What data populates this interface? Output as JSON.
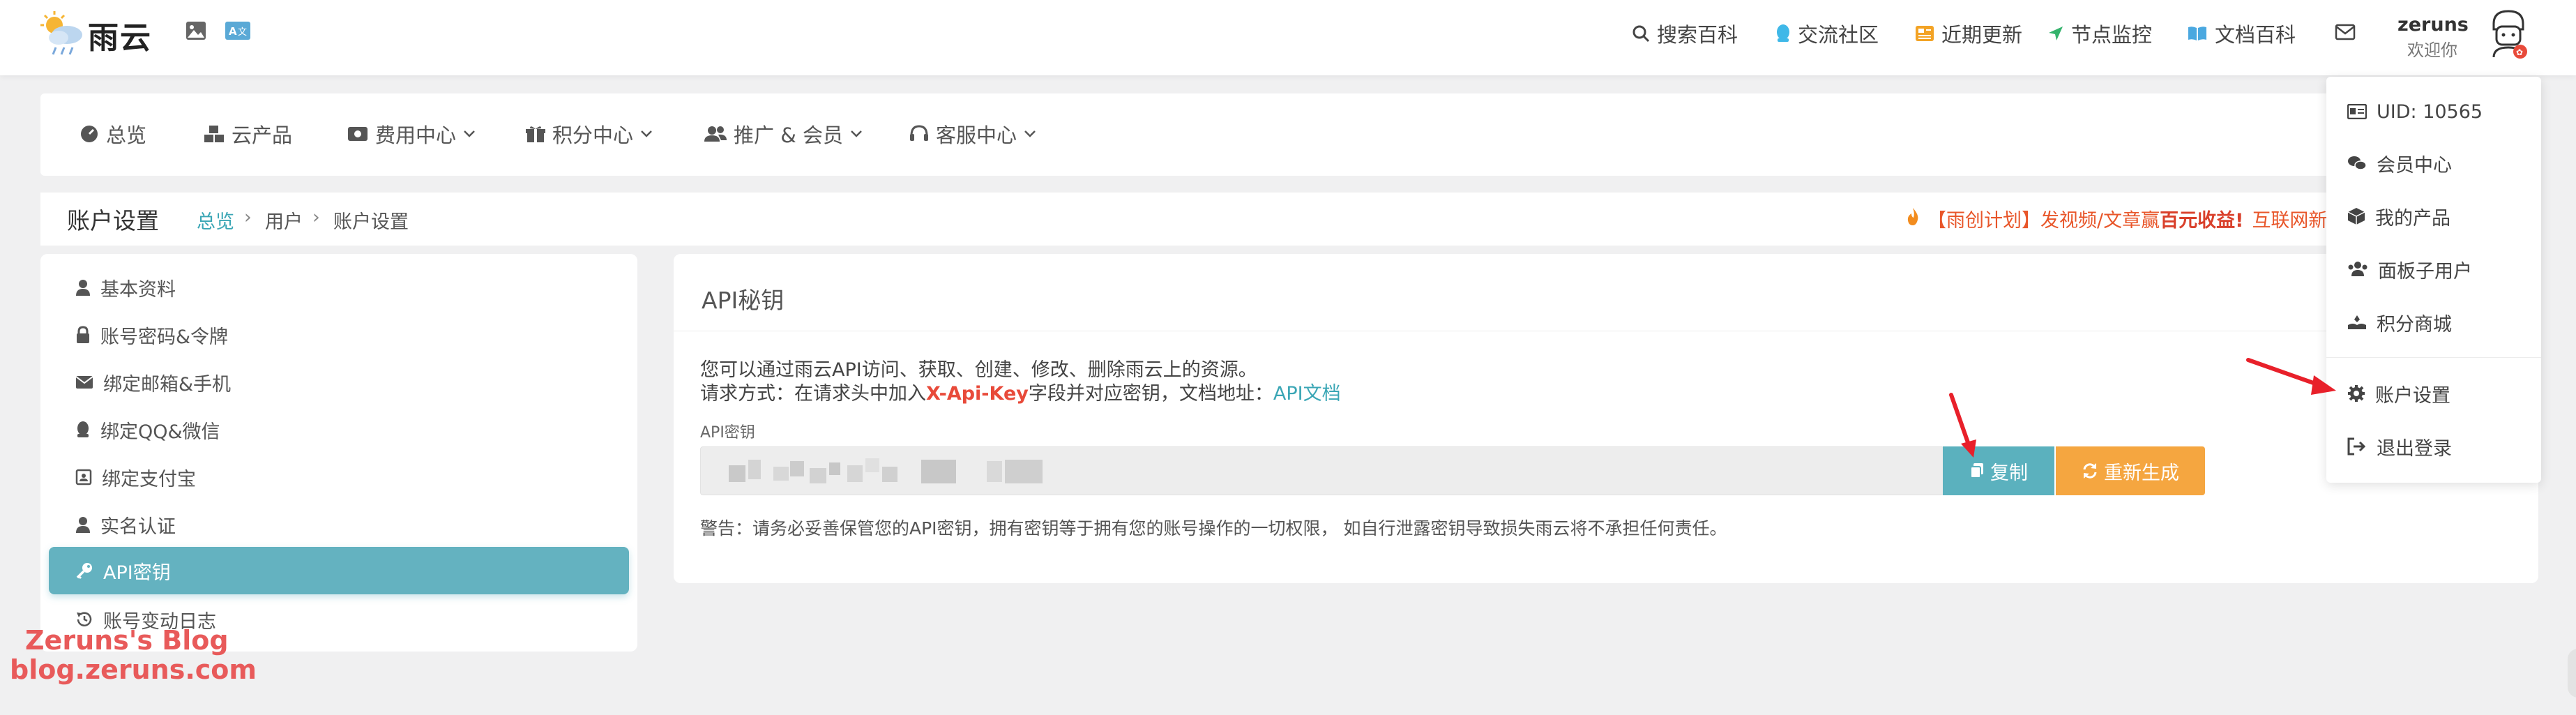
{
  "header": {
    "logo_text": "雨云",
    "nav": [
      "搜索百科",
      "交流社区",
      "近期更新",
      "节点监控",
      "文档百科"
    ],
    "username": "zeruns",
    "welcome": "欢迎你"
  },
  "menu": [
    "总览",
    "云产品",
    "费用中心",
    "积分中心",
    "推广 & 会员",
    "客服中心"
  ],
  "breadcrumb": {
    "title": "账户设置",
    "items": [
      "总览",
      "用户",
      "账户设置"
    ],
    "notice_prefix": "【雨创计划】发视频/文章赢",
    "notice_bold": "百元收益!",
    "notice_suffix": "互联网新"
  },
  "sidebar": {
    "items": [
      "基本资料",
      "账号密码&令牌",
      "绑定邮箱&手机",
      "绑定QQ&微信",
      "绑定支付宝",
      "实名认证",
      "API密钥",
      "账号变动日志"
    ],
    "active_index": 6
  },
  "api": {
    "title": "API秘钥",
    "desc_line1": "您可以通过雨云API访问、获取、创建、修改、删除雨云上的资源。",
    "desc_line2_prefix": "请求方式：在请求头中加入",
    "desc_line2_key": "X-Api-Key",
    "desc_line2_suffix": "字段并对应密钥，文档地址：",
    "doc_link": "API文档",
    "field_label": "API密钥",
    "copy_btn": "复制",
    "regen_btn": "重新生成",
    "warning": "警告：请务必妥善保管您的API密钥，拥有密钥等于拥有您的账号操作的一切权限， 如自行泄露密钥导致损失雨云将不承担任何责任。"
  },
  "dropdown": {
    "uid": "UID: 10565",
    "items": [
      "会员中心",
      "我的产品",
      "面板子用户",
      "积分商城",
      "账户设置",
      "退出登录"
    ]
  },
  "watermark": {
    "line1": "Zeruns's Blog",
    "line2": "blog.zeruns.com"
  },
  "colors": {
    "accent": "#64b2c0",
    "warning_orange": "#f5a640",
    "link": "#3aa6b5",
    "key_red": "#e84a3a",
    "arrow_red": "#e8202a"
  }
}
